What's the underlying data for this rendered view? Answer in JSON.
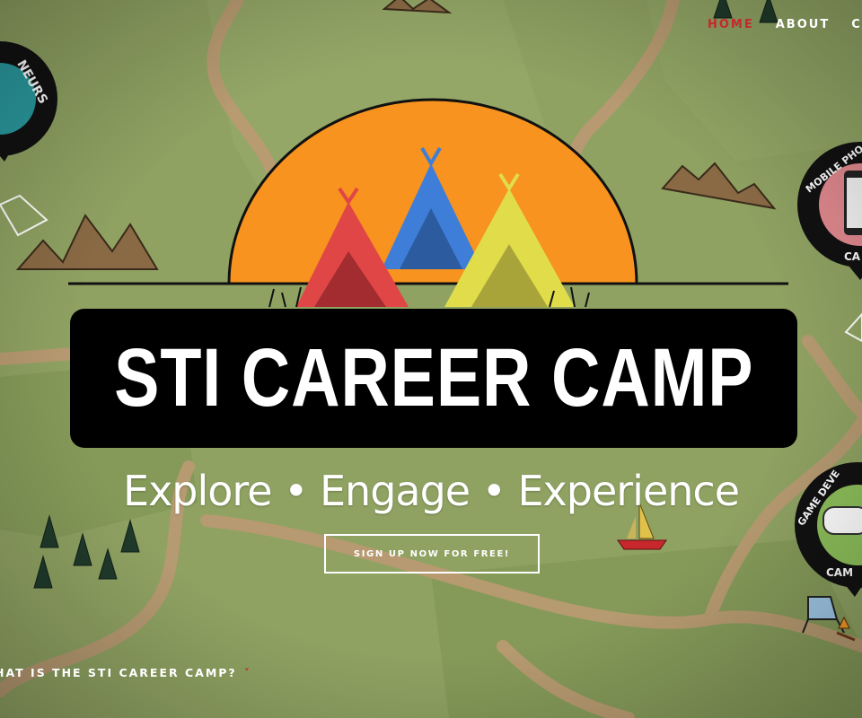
{
  "nav": {
    "items": [
      {
        "label": "HOME",
        "active": true
      },
      {
        "label": "ABOUT",
        "active": false
      },
      {
        "label": "CA",
        "active": false
      }
    ]
  },
  "hero": {
    "title": "STI CAREER CAMP",
    "tagline": "Explore • Engage • Experience",
    "cta_label": "SIGN UP NOW FOR FREE!"
  },
  "badges": [
    {
      "label": "...NEURS"
    },
    {
      "label": "MOBILE PHO...",
      "sub": "CA..."
    },
    {
      "label": "GAME DEVE...",
      "sub": "CAM..."
    }
  ],
  "scroll_link": {
    "label": "HAT IS THE STI CAREER CAMP?"
  },
  "colors": {
    "accent": "#c8272b",
    "map_green": "#8da060",
    "sun": "#f7931e",
    "tent_red": "#e04646",
    "tent_blue": "#3f7ed8",
    "tent_yellow": "#e1dd4a"
  }
}
